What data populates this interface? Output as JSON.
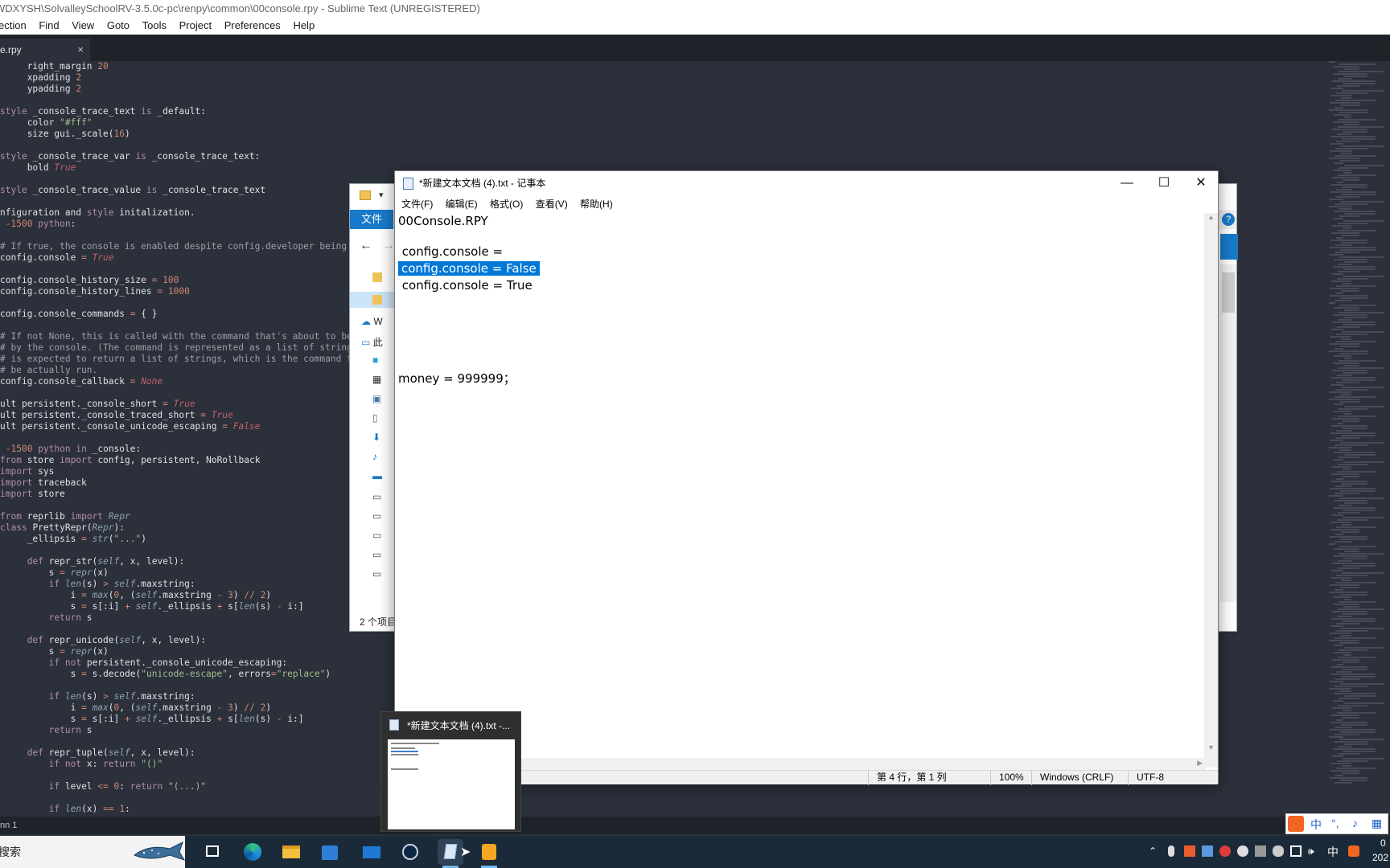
{
  "sublime": {
    "title": "WDXYSH\\SolvalleySchoolRV-3.5.0c-pc\\renpy\\common\\00console.rpy - Sublime Text (UNREGISTERED)",
    "menu": [
      "ection",
      "Find",
      "View",
      "Goto",
      "Tools",
      "Project",
      "Preferences",
      "Help"
    ],
    "tab_label": "e.rpy",
    "tab_close": "×",
    "status": "nn 1",
    "code_lines": [
      "     right_margin 20",
      "     xpadding 2",
      "     ypadding 2",
      "",
      "style _console_trace_text is _default:",
      "     color \"#fff\"",
      "     size gui._scale(16)",
      "",
      "style _console_trace_var is _console_trace_text:",
      "     bold True",
      "",
      "style _console_trace_value is _console_trace_text",
      "",
      "nfiguration and style initalization.",
      " -1500 python:",
      "",
      "# If true, the console is enabled despite config.developer being F",
      "config.console = True",
      "",
      "config.console_history_size = 100",
      "config.console_history_lines = 1000",
      "",
      "config.console_commands = { }",
      "",
      "# If not None, this is called with the command that's about to be",
      "# by the console. (The command is represented as a list of strings",
      "# is expected to return a list of strings, which is the command th",
      "# be actually run.",
      "config.console_callback = None",
      "",
      "ult persistent._console_short = True",
      "ult persistent._console_traced_short = True",
      "ult persistent._console_unicode_escaping = False",
      "",
      " -1500 python in _console:",
      "from store import config, persistent, NoRollback",
      "import sys",
      "import traceback",
      "import store",
      "",
      "from reprlib import Repr",
      "class PrettyRepr(Repr):",
      "     _ellipsis = str(\"...\")",
      "",
      "     def repr_str(self, x, level):",
      "         s = repr(x)",
      "         if len(s) > self.maxstring:",
      "             i = max(0, (self.maxstring - 3) // 2)",
      "             s = s[:i] + self._ellipsis + s[len(s) - i:]",
      "         return s",
      "",
      "     def repr_unicode(self, x, level):",
      "         s = repr(x)",
      "         if not persistent._console_unicode_escaping:",
      "             s = s.decode(\"unicode-escape\", errors=\"replace\")",
      "",
      "         if len(s) > self.maxstring:",
      "             i = max(0, (self.maxstring - 3) // 2)",
      "             s = s[:i] + self._ellipsis + s[len(s) - i:]",
      "         return s",
      "",
      "     def repr_tuple(self, x, level):",
      "         if not x: return \"()\"",
      "",
      "         if level <= 0: return \"(...)\"",
      "",
      "         if len(x) == 1:"
    ]
  },
  "explorer": {
    "file_tab": "文件",
    "status": "2 个项目",
    "sidebar_items": [
      "W",
      "此"
    ]
  },
  "notepad": {
    "title": "*新建文本文档 (4).txt - 记事本",
    "menu": [
      "文件(F)",
      "编辑(E)",
      "格式(O)",
      "查看(V)",
      "帮助(H)"
    ],
    "minimize": "—",
    "maximize": "☐",
    "close": "✕",
    "lines": {
      "l1": "00Console.RPY",
      "l3": " config.console =",
      "l4": "config.console = False",
      "l5": " config.console = True",
      "l11": "money = 999999；"
    },
    "status": {
      "position": "第 4 行，第 1 列",
      "zoom": "100%",
      "eol": "Windows (CRLF)",
      "encoding": "UTF-8"
    }
  },
  "thumbnail": {
    "title": "*新建文本文档 (4).txt -..."
  },
  "taskbar": {
    "search": "搜索",
    "tray_ime": "中",
    "clock_time": "0",
    "clock_date": "202"
  },
  "colors": {
    "sublime_bg": "#2b303b",
    "keyword": "#b48ead",
    "number": "#d08770",
    "string": "#a3be8c",
    "constant": "#bf616a",
    "function": "#8fa1b3",
    "selection": "#0078d7",
    "taskbar": "#1b2a38"
  }
}
